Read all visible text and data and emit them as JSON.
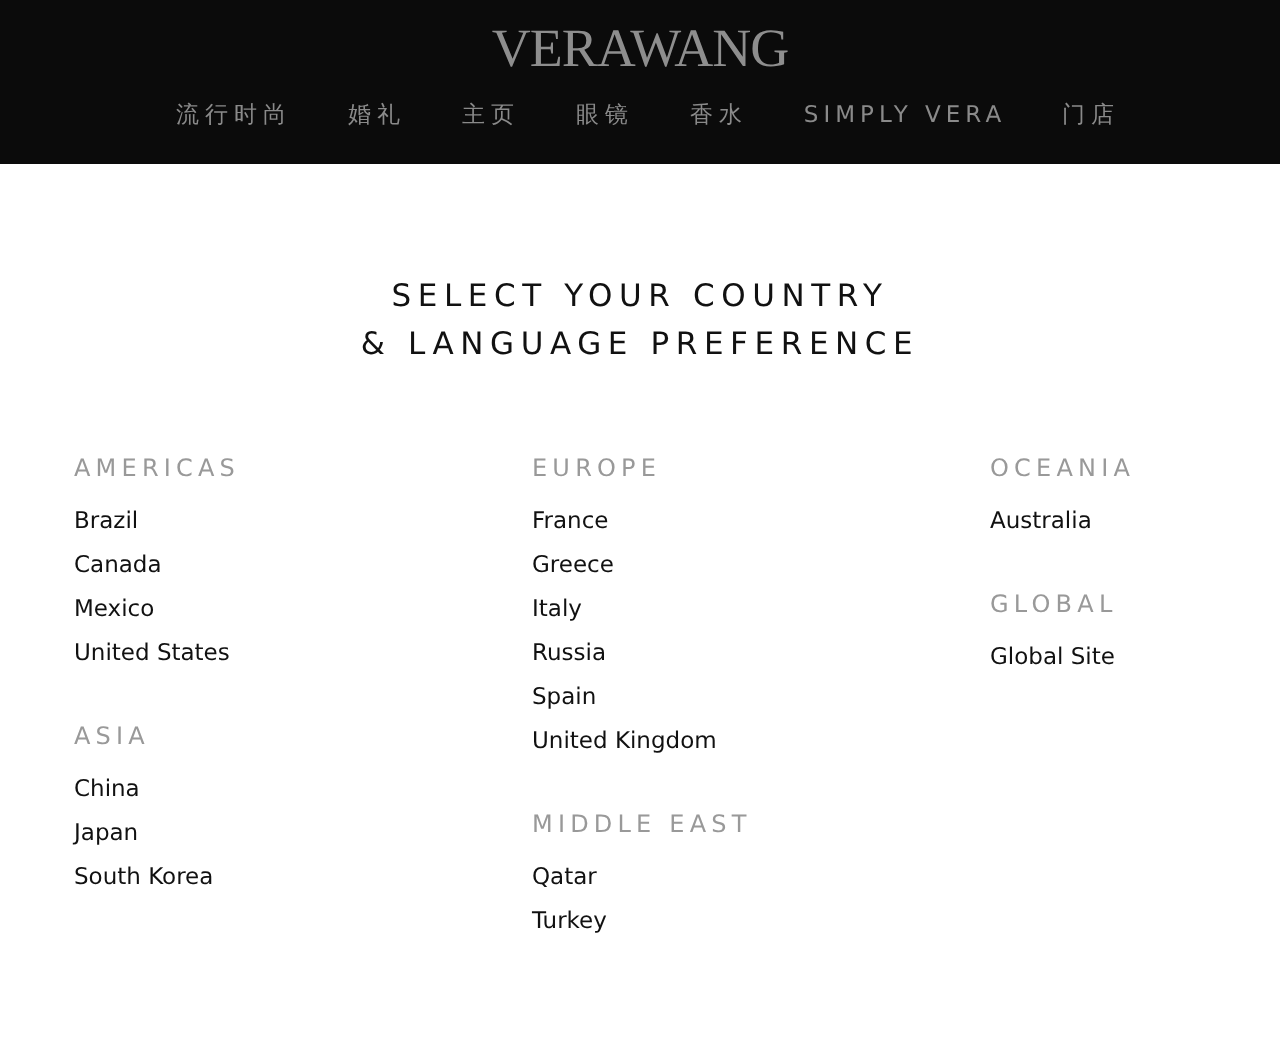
{
  "header": {
    "logo": "VERAWANG",
    "nav": [
      "流行时尚",
      "婚礼",
      "主页",
      "眼镜",
      "香水",
      "SIMPLY VERA",
      "门店"
    ]
  },
  "title": [
    "SELECT YOUR COUNTRY",
    "& LANGUAGE PREFERENCE"
  ],
  "columns": [
    {
      "regions": [
        {
          "name": "AMERICAS",
          "countries": [
            "Brazil",
            "Canada",
            "Mexico",
            "United States"
          ]
        },
        {
          "name": "ASIA",
          "countries": [
            "China",
            "Japan",
            "South Korea"
          ]
        }
      ]
    },
    {
      "regions": [
        {
          "name": "EUROPE",
          "countries": [
            "France",
            "Greece",
            "Italy",
            "Russia",
            "Spain",
            "United Kingdom"
          ]
        },
        {
          "name": "MIDDLE EAST",
          "countries": [
            "Qatar",
            "Turkey"
          ]
        }
      ]
    },
    {
      "regions": [
        {
          "name": "OCEANIA",
          "countries": [
            "Australia"
          ]
        },
        {
          "name": "GLOBAL",
          "countries": [
            "Global Site"
          ]
        }
      ]
    }
  ]
}
